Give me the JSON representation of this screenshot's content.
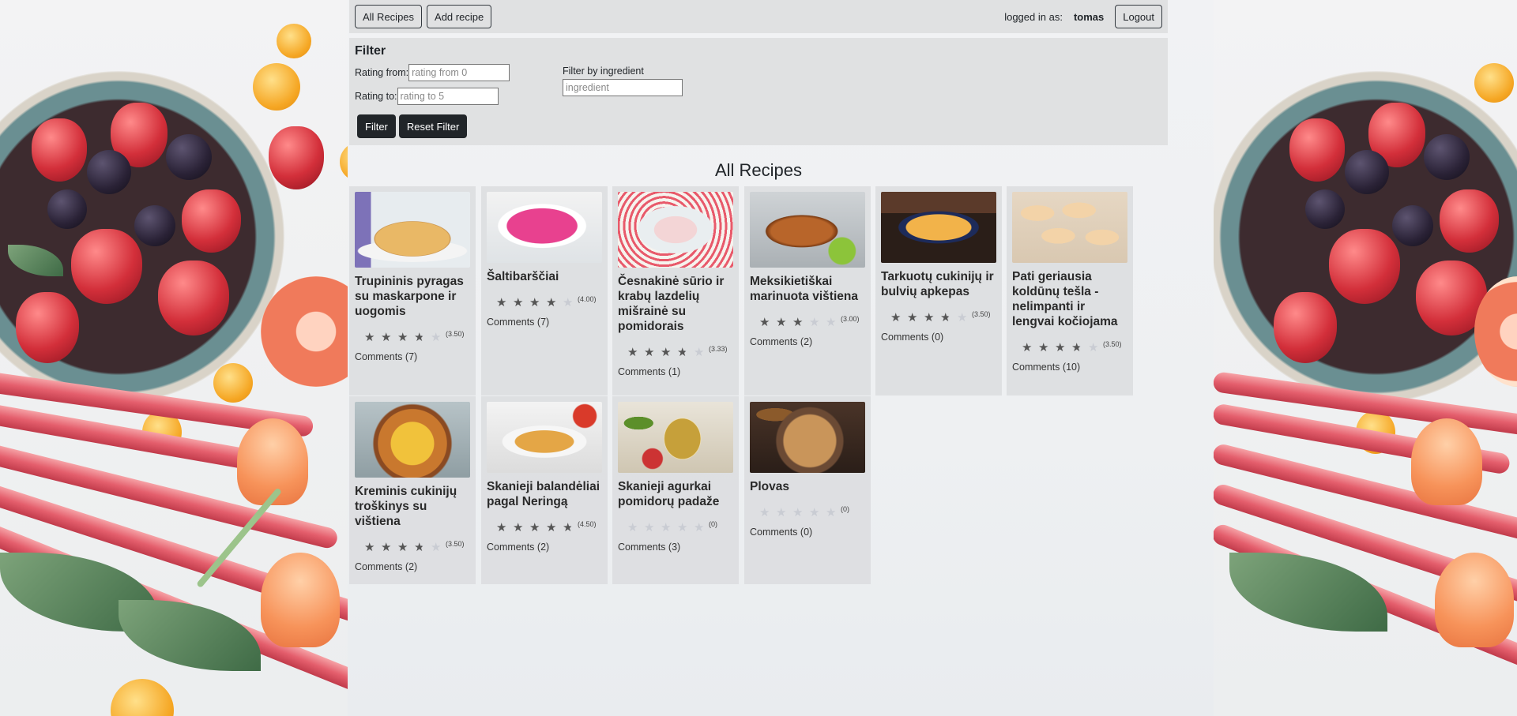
{
  "nav": {
    "all_recipes": "All Recipes",
    "add_recipe": "Add recipe",
    "logged_in_label": "logged in as:",
    "username": "tomas",
    "logout": "Logout"
  },
  "filter": {
    "title": "Filter",
    "rating_from_label": "Rating from:",
    "rating_from_placeholder": "rating from 0",
    "rating_to_label": "Rating to:",
    "rating_to_placeholder": "rating to 5",
    "ingredient_label": "Filter by ingredient",
    "ingredient_placeholder": "ingredient",
    "filter_button": "Filter",
    "reset_button": "Reset Filter"
  },
  "page_title": "All Recipes",
  "recipes": [
    {
      "title": "Trupininis pyragas su maskarpone ir uogomis",
      "rating": 3.5,
      "rating_text": "(3.50)",
      "comments": "Comments (7)",
      "thumb": "cake"
    },
    {
      "title": "Šaltibarščiai",
      "rating": 4.0,
      "rating_text": "(4.00)",
      "comments": "Comments (7)",
      "thumb": "pink-soup"
    },
    {
      "title": "Česnakinė sūrio ir krabų lazdelių mišrainė su pomidorais",
      "rating": 3.33,
      "rating_text": "(3.33)",
      "comments": "Comments (1)",
      "thumb": "salad"
    },
    {
      "title": "Meksikietiškai marinuota vištiena",
      "rating": 3.0,
      "rating_text": "(3.00)",
      "comments": "Comments (2)",
      "thumb": "chicken"
    },
    {
      "title": "Tarkuotų cukinijų ir bulvių apkepas",
      "rating": 3.5,
      "rating_text": "(3.50)",
      "comments": "Comments (0)",
      "thumb": "casserole"
    },
    {
      "title": "Pati geriausia koldūnų tešla - nelimpanti ir lengvai kočiojama",
      "rating": 3.5,
      "rating_text": "(3.50)",
      "comments": "Comments (10)",
      "thumb": "dumplings"
    },
    {
      "title": "Kreminis cukinijų troškinys su vištiena",
      "rating": 3.5,
      "rating_text": "(3.50)",
      "comments": "Comments (2)",
      "thumb": "stew"
    },
    {
      "title": "Skanieji balandėliai pagal Neringą",
      "rating": 4.5,
      "rating_text": "(4.50)",
      "comments": "Comments (2)",
      "thumb": "cabbage-rolls"
    },
    {
      "title": "Skanieji agurkai pomidorų padaže",
      "rating": 0,
      "rating_text": "(0)",
      "comments": "Comments (3)",
      "thumb": "pickles"
    },
    {
      "title": "Plovas",
      "rating": 0,
      "rating_text": "(0)",
      "comments": "Comments (0)",
      "thumb": "plov"
    }
  ]
}
